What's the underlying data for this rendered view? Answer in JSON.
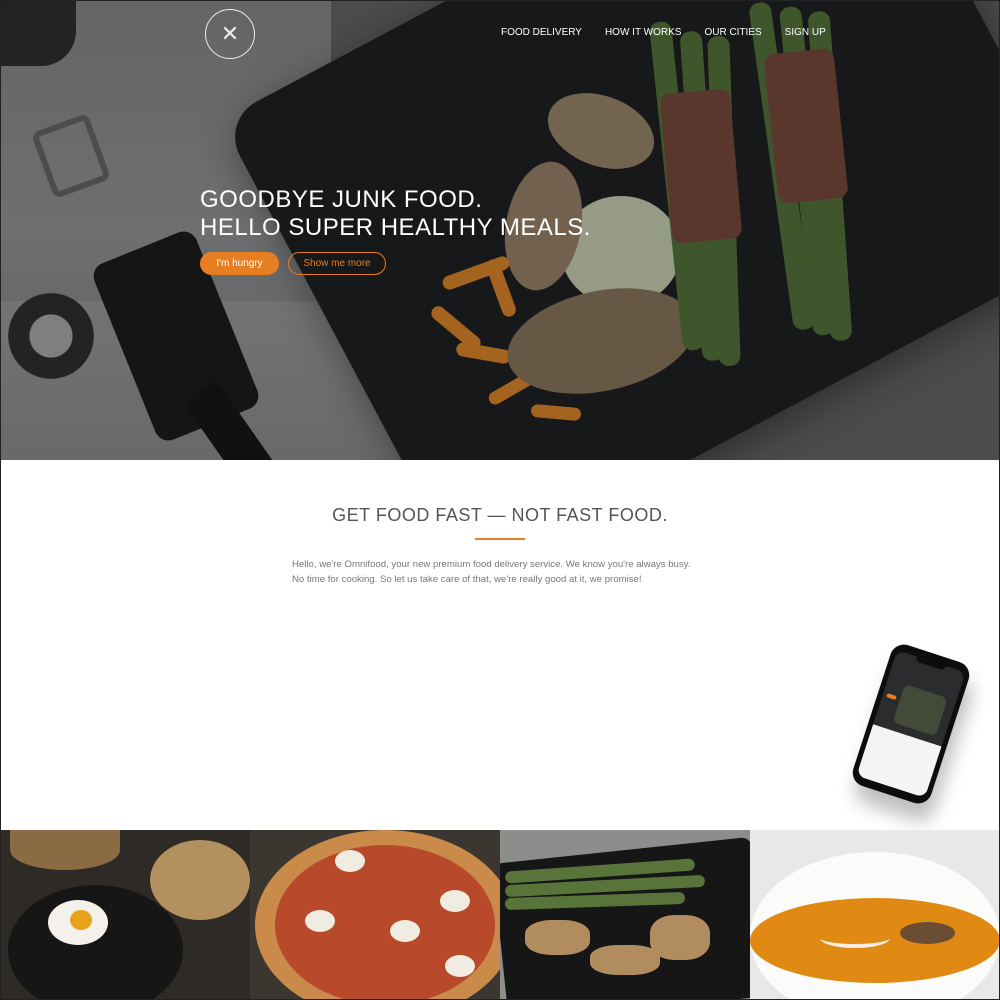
{
  "header": {
    "logo_icon": "fork-spoon-icon",
    "nav": [
      {
        "label": "FOOD DELIVERY"
      },
      {
        "label": "HOW IT WORKS"
      },
      {
        "label": "OUR CITIES"
      },
      {
        "label": "SIGN UP"
      }
    ]
  },
  "hero": {
    "headline_line1": "GOODBYE JUNK FOOD.",
    "headline_line2": "HELLO SUPER HEALTHY MEALS.",
    "primary_button": "I'm hungry",
    "secondary_button": "Show me more"
  },
  "about": {
    "title": "GET FOOD FAST — NOT FAST FOOD.",
    "text_line1": "Hello, we're Omnifood, your new premium food delivery service. We know you're always busy.",
    "text_line2": "No time for cooking. So let us take care of that, we're really good at it, we promise!"
  },
  "meals": [
    {
      "name": "bibimbap-photo"
    },
    {
      "name": "pizza-photo"
    },
    {
      "name": "chicken-asparagus-photo"
    },
    {
      "name": "pumpkin-soup-photo"
    }
  ],
  "colors": {
    "accent": "#e67e22",
    "text": "#555555",
    "hero_text": "#ffffff"
  }
}
